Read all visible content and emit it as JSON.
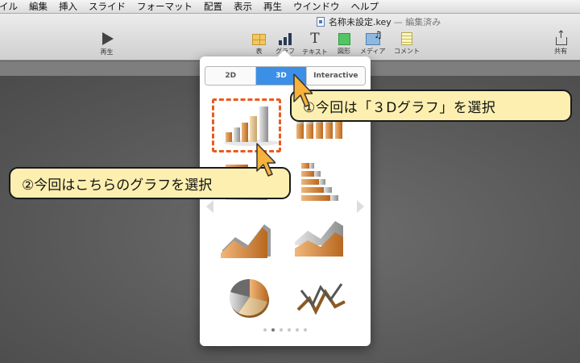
{
  "menubar": {
    "items": [
      "イル",
      "編集",
      "挿入",
      "スライド",
      "フォーマット",
      "配置",
      "表示",
      "再生",
      "ウインドウ",
      "ヘルプ"
    ]
  },
  "window": {
    "title": "名称未設定.key",
    "status": "— 編集済み"
  },
  "toolbar": {
    "play_label": "再生",
    "table_label": "表",
    "chart_label": "グラフ",
    "text_label": "テキスト",
    "shape_label": "図形",
    "media_label": "メディア",
    "comment_label": "コメント",
    "share_label": "共有"
  },
  "chart_picker": {
    "tabs": [
      {
        "label": "2D",
        "selected": false
      },
      {
        "label": "3D",
        "selected": true
      },
      {
        "label": "Interactive",
        "selected": false
      }
    ],
    "chart_types": [
      "3d-bar",
      "3d-stacked-bar",
      "3d-horizontal-bar",
      "3d-stacked-horizontal-bar",
      "3d-area",
      "3d-stacked-area",
      "3d-pie",
      "3d-line"
    ],
    "page_count": 6,
    "current_page": 2
  },
  "annotations": {
    "callout_1": "①今回は「３Dグラフ」を選択",
    "callout_2": "②今回はこちらのグラフを選択"
  },
  "colors": {
    "accent_blue": "#3c8fe6",
    "callout_fill": "#fcefb0",
    "highlight_orange": "#e85b1e"
  }
}
